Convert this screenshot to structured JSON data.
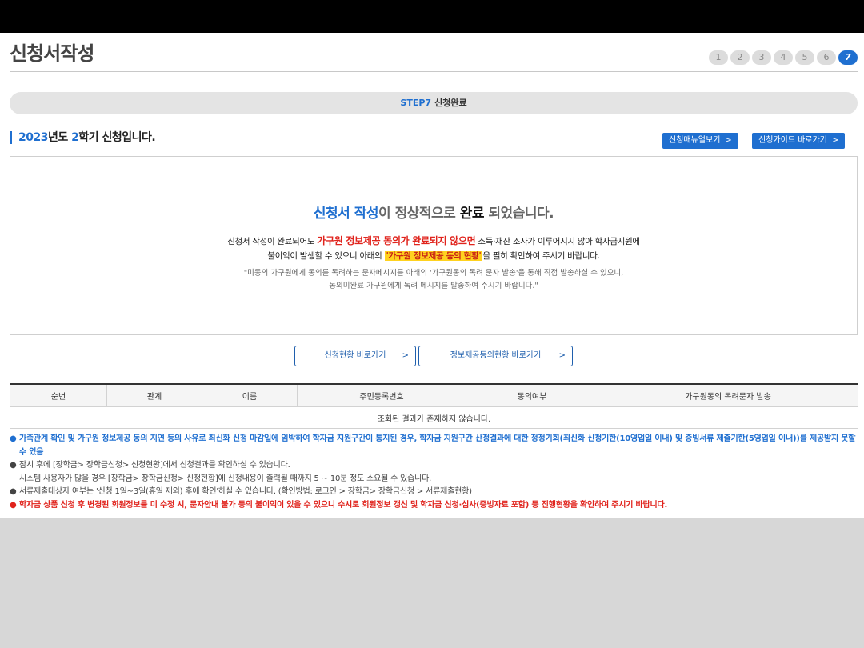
{
  "header": {
    "title": "신청서작성"
  },
  "steps": [
    "1",
    "2",
    "3",
    "4",
    "5",
    "6",
    "7"
  ],
  "stepbar": {
    "label": "STEP7",
    "text": "신청완료"
  },
  "semester": {
    "year": "2023",
    "part1": "년도 ",
    "term": "2",
    "part2": "학기 신청입니다."
  },
  "buttons": {
    "manual": "신청매뉴얼보기",
    "guide": "신청가이드 바로가기",
    "chevron": ">"
  },
  "completion": {
    "part1": "신청서 작성",
    "part2": "이 정상적으로 ",
    "part3": "완료",
    "part4": " 되었습니다.",
    "line1a": "신청서 작성이 완료되어도 ",
    "line1b": "가구원 정보제공 동의가 완료되지 않으면",
    "line1c": " 소득·재산 조사가 이루어지지 않아 학자금지원에",
    "line2a": "불이익이 발생할 수 있으니 아래의 ",
    "line2b": "'가구원 정보제공 동의 현황'",
    "line2c": "을 필히 확인하여 주시기 바랍니다.",
    "line3": "\"미동의 가구원에게 동의를 독려하는 문자메시지를 아래의 '가구원동의 독려 문자 발송'을 통해 직접 발송하실 수 있으니,",
    "line4": "동의미완료 가구원에게 독려 메시지를 발송하여 주시기 바랍니다.\""
  },
  "links": {
    "status": "신청현황 바로가기",
    "consent": "정보제공동의현황 바로가기"
  },
  "table": {
    "headers": [
      "순번",
      "관계",
      "이름",
      "주민등록번호",
      "동의여부",
      "가구원동의 독려문자 발송"
    ],
    "empty": "조회된 결과가 존재하지 않습니다."
  },
  "notes": {
    "n1": "가족관계 확인 및 가구원 정보제공 동의 지연 등의 사유로 최신화 신청 마감일에 임박하여 학자금 지원구간이 통지된 경우, 학자금 지원구간 산정결과에 대한 정정기회(최신화 신청기한(10영업일 이내) 및 증빙서류 제출기한(5영업일 이내))를 제공받지 못할 수 있음",
    "n2a": "잠시 후에 [장학금> 장학금신청> 신청현황]에서 신청결과를 확인하실 수 있습니다.",
    "n2b": "시스템 사용자가 많을 경우 [장학금> 장학금신청> 신청현황]에 신청내용이 출력될 때까지 5 ~ 10분 정도 소요될 수 있습니다.",
    "n3": "서류제출대상자 여부는 '신청 1일~3일(휴일 제외) 후에 확인'하실 수 있습니다. (확인방법: 로그인 > 장학금> 장학금신청 > 서류제출현황)",
    "n4": "학자금 상품 신청 후 변경된 회원정보를 미 수정 시, 문자안내 불가 등의 불이익이 있을 수 있으니 수시로 회원정보 갱신 및 학자금 신청·심사(증빙자료 포함) 등 진행현황을 확인하여 주시기 바랍니다.",
    "bullet": "●"
  },
  "colors": {
    "accent": "#1f6fd0",
    "warning": "#e0231c",
    "highlight": "#ffd21f"
  }
}
